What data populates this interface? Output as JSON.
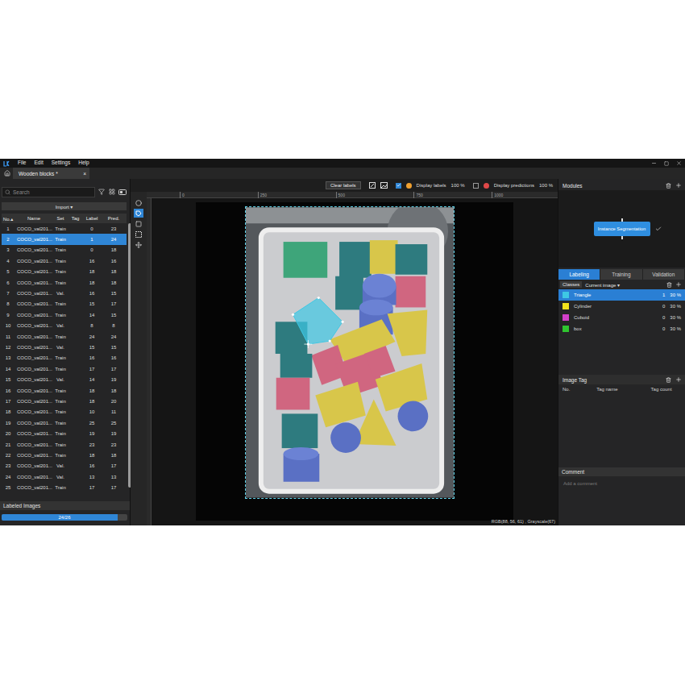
{
  "window": {
    "title": "Wooden blocks *"
  },
  "menu": [
    "File",
    "Edit",
    "Settings",
    "Help"
  ],
  "tabs": [
    {
      "label": "Wooden blocks *",
      "selected": true,
      "close": "×"
    }
  ],
  "search": {
    "placeholder": "Search"
  },
  "import_button": "Import ▾",
  "table": {
    "columns": [
      "No.▴",
      "Name",
      "Set",
      "Tag",
      "Label",
      "Pred."
    ],
    "rows": [
      {
        "no": "1",
        "name": "COCO_val201...",
        "set": "Train",
        "tag": "",
        "label": "0",
        "pred": "23",
        "selected": false
      },
      {
        "no": "2",
        "name": "COCO_val201...",
        "set": "Train",
        "tag": "",
        "label": "1",
        "pred": "24",
        "selected": true
      },
      {
        "no": "3",
        "name": "COCO_val201...",
        "set": "Train",
        "tag": "",
        "label": "0",
        "pred": "18",
        "selected": false
      },
      {
        "no": "4",
        "name": "COCO_val201...",
        "set": "Train",
        "tag": "",
        "label": "16",
        "pred": "16",
        "selected": false
      },
      {
        "no": "5",
        "name": "COCO_val201...",
        "set": "Train",
        "tag": "",
        "label": "18",
        "pred": "18",
        "selected": false
      },
      {
        "no": "6",
        "name": "COCO_val201...",
        "set": "Train",
        "tag": "",
        "label": "18",
        "pred": "18",
        "selected": false
      },
      {
        "no": "7",
        "name": "COCO_val201...",
        "set": "Val.",
        "tag": "",
        "label": "16",
        "pred": "15",
        "selected": false
      },
      {
        "no": "8",
        "name": "COCO_val201...",
        "set": "Train",
        "tag": "",
        "label": "15",
        "pred": "17",
        "selected": false
      },
      {
        "no": "9",
        "name": "COCO_val201...",
        "set": "Train",
        "tag": "",
        "label": "14",
        "pred": "15",
        "selected": false
      },
      {
        "no": "10",
        "name": "COCO_val201...",
        "set": "Val.",
        "tag": "",
        "label": "8",
        "pred": "8",
        "selected": false
      },
      {
        "no": "11",
        "name": "COCO_val201...",
        "set": "Train",
        "tag": "",
        "label": "24",
        "pred": "24",
        "selected": false
      },
      {
        "no": "12",
        "name": "COCO_val201...",
        "set": "Val.",
        "tag": "",
        "label": "15",
        "pred": "15",
        "selected": false
      },
      {
        "no": "13",
        "name": "COCO_val201...",
        "set": "Train",
        "tag": "",
        "label": "16",
        "pred": "16",
        "selected": false
      },
      {
        "no": "14",
        "name": "COCO_val201...",
        "set": "Train",
        "tag": "",
        "label": "17",
        "pred": "17",
        "selected": false
      },
      {
        "no": "15",
        "name": "COCO_val201...",
        "set": "Val.",
        "tag": "",
        "label": "14",
        "pred": "19",
        "selected": false
      },
      {
        "no": "16",
        "name": "COCO_val201...",
        "set": "Train",
        "tag": "",
        "label": "18",
        "pred": "18",
        "selected": false
      },
      {
        "no": "17",
        "name": "COCO_val201...",
        "set": "Train",
        "tag": "",
        "label": "18",
        "pred": "20",
        "selected": false
      },
      {
        "no": "18",
        "name": "COCO_val201...",
        "set": "Train",
        "tag": "",
        "label": "10",
        "pred": "11",
        "selected": false
      },
      {
        "no": "19",
        "name": "COCO_val201...",
        "set": "Train",
        "tag": "",
        "label": "25",
        "pred": "25",
        "selected": false
      },
      {
        "no": "20",
        "name": "COCO_val201...",
        "set": "Train",
        "tag": "",
        "label": "19",
        "pred": "19",
        "selected": false
      },
      {
        "no": "21",
        "name": "COCO_val201...",
        "set": "Train",
        "tag": "",
        "label": "23",
        "pred": "23",
        "selected": false
      },
      {
        "no": "22",
        "name": "COCO_val201...",
        "set": "Train",
        "tag": "",
        "label": "18",
        "pred": "18",
        "selected": false
      },
      {
        "no": "23",
        "name": "COCO_val201...",
        "set": "Val.",
        "tag": "",
        "label": "16",
        "pred": "17",
        "selected": false
      },
      {
        "no": "24",
        "name": "COCO_val201...",
        "set": "Val.",
        "tag": "",
        "label": "13",
        "pred": "13",
        "selected": false
      },
      {
        "no": "25",
        "name": "COCO_val201...",
        "set": "Train",
        "tag": "",
        "label": "17",
        "pred": "17",
        "selected": false
      }
    ]
  },
  "labeled_images": {
    "title": "Labeled Images",
    "progress": "24/26",
    "level": 0.923
  },
  "toolbar": {
    "clear_labels": "Clear labels",
    "display_labels": {
      "label": "Display labels",
      "checked": true,
      "opacity": "100 %"
    },
    "display_predictions": {
      "label": "Display predictions",
      "checked": false,
      "opacity": "100 %"
    }
  },
  "ruler": [
    "0",
    "250",
    "500",
    "750",
    "1000"
  ],
  "tools": [
    {
      "kind": "ellipse",
      "selected": false
    },
    {
      "kind": "polygon",
      "selected": true
    },
    {
      "kind": "rect",
      "selected": false
    },
    {
      "kind": "dashed-rect",
      "selected": false
    },
    {
      "kind": "move",
      "selected": false
    }
  ],
  "status": "RGB(88, 56, 61) , Grayscale(67)",
  "modules": {
    "title": "Modules",
    "node": "Instance Segmentation",
    "done": true
  },
  "panel_tabs": [
    {
      "label": "Labeling",
      "selected": true
    },
    {
      "label": "Training",
      "selected": false
    },
    {
      "label": "Validation",
      "selected": false
    }
  ],
  "classes": {
    "title": "Classes",
    "filter": "Current image ▾",
    "items": [
      {
        "name": "Triangle",
        "count": "1",
        "threshold": "30 %",
        "color": "#3ec8e4",
        "selected": true
      },
      {
        "name": "Cylinder",
        "count": "0",
        "threshold": "30 %",
        "color": "#f2e21c",
        "selected": false
      },
      {
        "name": "Cuboid",
        "count": "0",
        "threshold": "30 %",
        "color": "#d23fc9",
        "selected": false
      },
      {
        "name": "box",
        "count": "0",
        "threshold": "30 %",
        "color": "#2fc52f",
        "selected": false
      }
    ]
  },
  "image_tag": {
    "title": "Image Tag",
    "columns": [
      "No.",
      "Tag name",
      "Tag count"
    ]
  },
  "comment": {
    "title": "Comment",
    "placeholder": "Add a comment"
  }
}
